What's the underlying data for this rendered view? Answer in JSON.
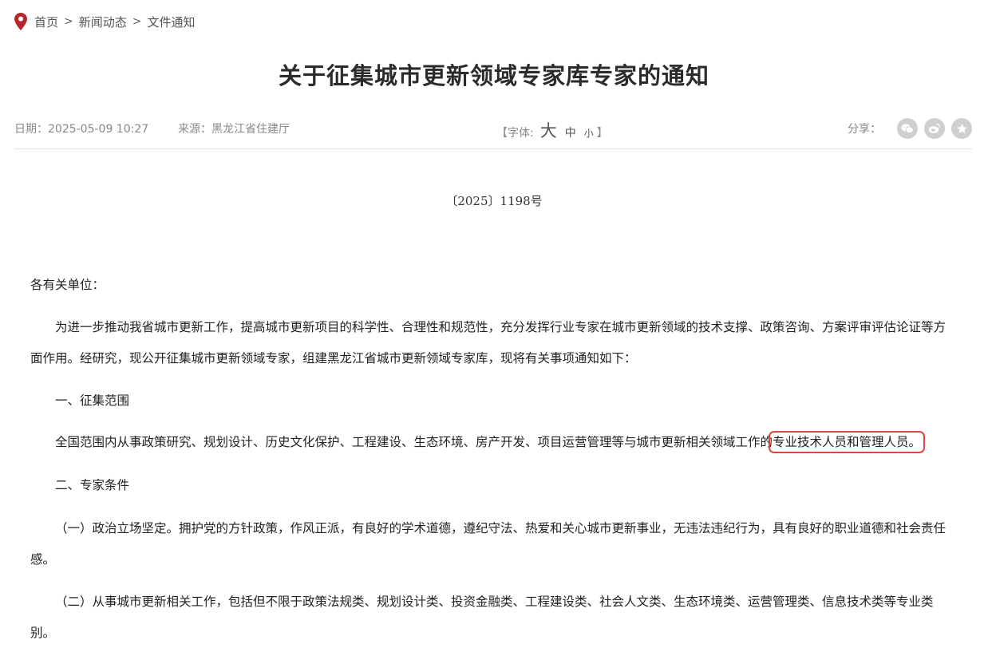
{
  "breadcrumb": {
    "items": [
      "首页",
      "新闻动态",
      "文件通知"
    ],
    "separator": ">"
  },
  "article": {
    "title": "关于征集城市更新领域专家库专家的通知",
    "date": "日期：2025-05-09 10:27",
    "source": "来源：黑龙江省住建厅"
  },
  "font_size": {
    "open": "【字体:",
    "large": "大",
    "medium": "中",
    "small": "小",
    "close": "】"
  },
  "share": {
    "label": "分享：",
    "icons": [
      "wechat-icon",
      "weibo-icon",
      "favorite-icon"
    ]
  },
  "content": {
    "doc_number": "〔2025〕1198号",
    "salutation": "各有关单位：",
    "intro": "为进一步推动我省城市更新工作，提高城市更新项目的科学性、合理性和规范性，充分发挥行业专家在城市更新领域的技术支撑、政策咨询、方案评审评估论证等方面作用。经研究，现公开征集城市更新领域专家，组建黑龙江省城市更新领域专家库，现将有关事项通知如下：",
    "section1": "一、征集范围",
    "scope_text": "全国范围内从事政策研究、规划设计、历史文化保护、工程建设、生态环境、房产开发、项目运营管理等与城市更新相关领域工作的",
    "scope_highlight": "专业技术人员和管理人员。",
    "section2": "二、专家条件",
    "cond1": "（一）政治立场坚定。拥护党的方针政策，作风正派，有良好的学术道德，遵纪守法、热爱和关心城市更新事业，无违法违纪行为，具有良好的职业道德和社会责任感。",
    "cond2": "（二）从事城市更新相关工作，包括但不限于政策法规类、规划设计类、投资金融类、工程建设类、社会人文类、生态环境类、运营管理类、信息技术类等专业类别。"
  },
  "colors": {
    "pin": "#b3282d",
    "highlight_box": "#e0463e",
    "share_icon_bg": "#cfcfcf"
  }
}
